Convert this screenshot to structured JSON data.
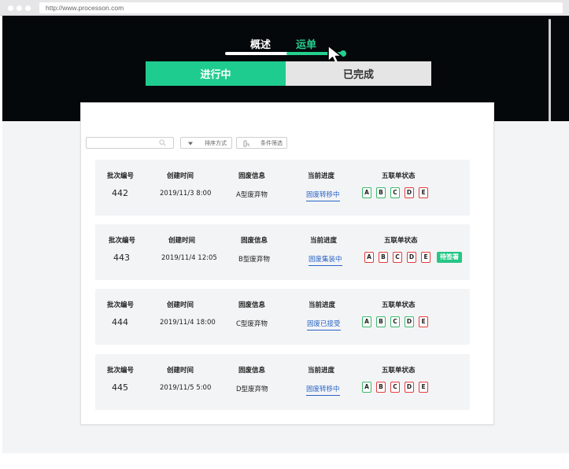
{
  "browser": {
    "url": "http://www.processon.com"
  },
  "nav": {
    "overview": "概述",
    "waybill": "运单"
  },
  "segments": {
    "active": "进行中",
    "done": "已完成"
  },
  "toolbar": {
    "search_placeholder": "",
    "sort_label": "排序方式",
    "filter_label": "条件筛选"
  },
  "columns": {
    "batch": "批次编号",
    "created": "创建时间",
    "waste": "固废信息",
    "progress": "当前进度",
    "status": "五联单状态"
  },
  "rows": [
    {
      "batch": "442",
      "created": "2019/11/3 8:00",
      "waste": "A型废弃物",
      "progress": "固废转移中",
      "badges": [
        {
          "letter": "A",
          "color": "green"
        },
        {
          "letter": "B",
          "color": "green"
        },
        {
          "letter": "C",
          "color": "green"
        },
        {
          "letter": "D",
          "color": "red"
        },
        {
          "letter": "E",
          "color": "red"
        }
      ],
      "tag": ""
    },
    {
      "batch": "443",
      "created": "2019/11/4 12:05",
      "waste": "B型废弃物",
      "progress": "固废集装中",
      "badges": [
        {
          "letter": "A",
          "color": "red"
        },
        {
          "letter": "B",
          "color": "red"
        },
        {
          "letter": "C",
          "color": "red"
        },
        {
          "letter": "D",
          "color": "red"
        },
        {
          "letter": "E",
          "color": "red"
        }
      ],
      "tag": "待签署"
    },
    {
      "batch": "444",
      "created": "2019/11/4 18:00",
      "waste": "C型废弃物",
      "progress": "固废已接受",
      "badges": [
        {
          "letter": "A",
          "color": "green"
        },
        {
          "letter": "B",
          "color": "green"
        },
        {
          "letter": "C",
          "color": "green"
        },
        {
          "letter": "D",
          "color": "green"
        },
        {
          "letter": "E",
          "color": "red"
        }
      ],
      "tag": ""
    },
    {
      "batch": "445",
      "created": "2019/11/5 5:00",
      "waste": "D型废弃物",
      "progress": "固废转移中",
      "badges": [
        {
          "letter": "A",
          "color": "green"
        },
        {
          "letter": "B",
          "color": "red"
        },
        {
          "letter": "C",
          "color": "red"
        },
        {
          "letter": "D",
          "color": "red"
        },
        {
          "letter": "E",
          "color": "red"
        }
      ],
      "tag": ""
    }
  ],
  "colors": {
    "accent": "#1fcc8f",
    "link": "#2a64c6",
    "badge_red": "#e53b3b",
    "badge_green": "#3bb86b",
    "header_bg": "#05080b"
  },
  "icons": {
    "search": "search-icon",
    "sort": "triangle-down-icon",
    "filter": "filter-icon",
    "cursor": "cursor-arrow-icon"
  }
}
